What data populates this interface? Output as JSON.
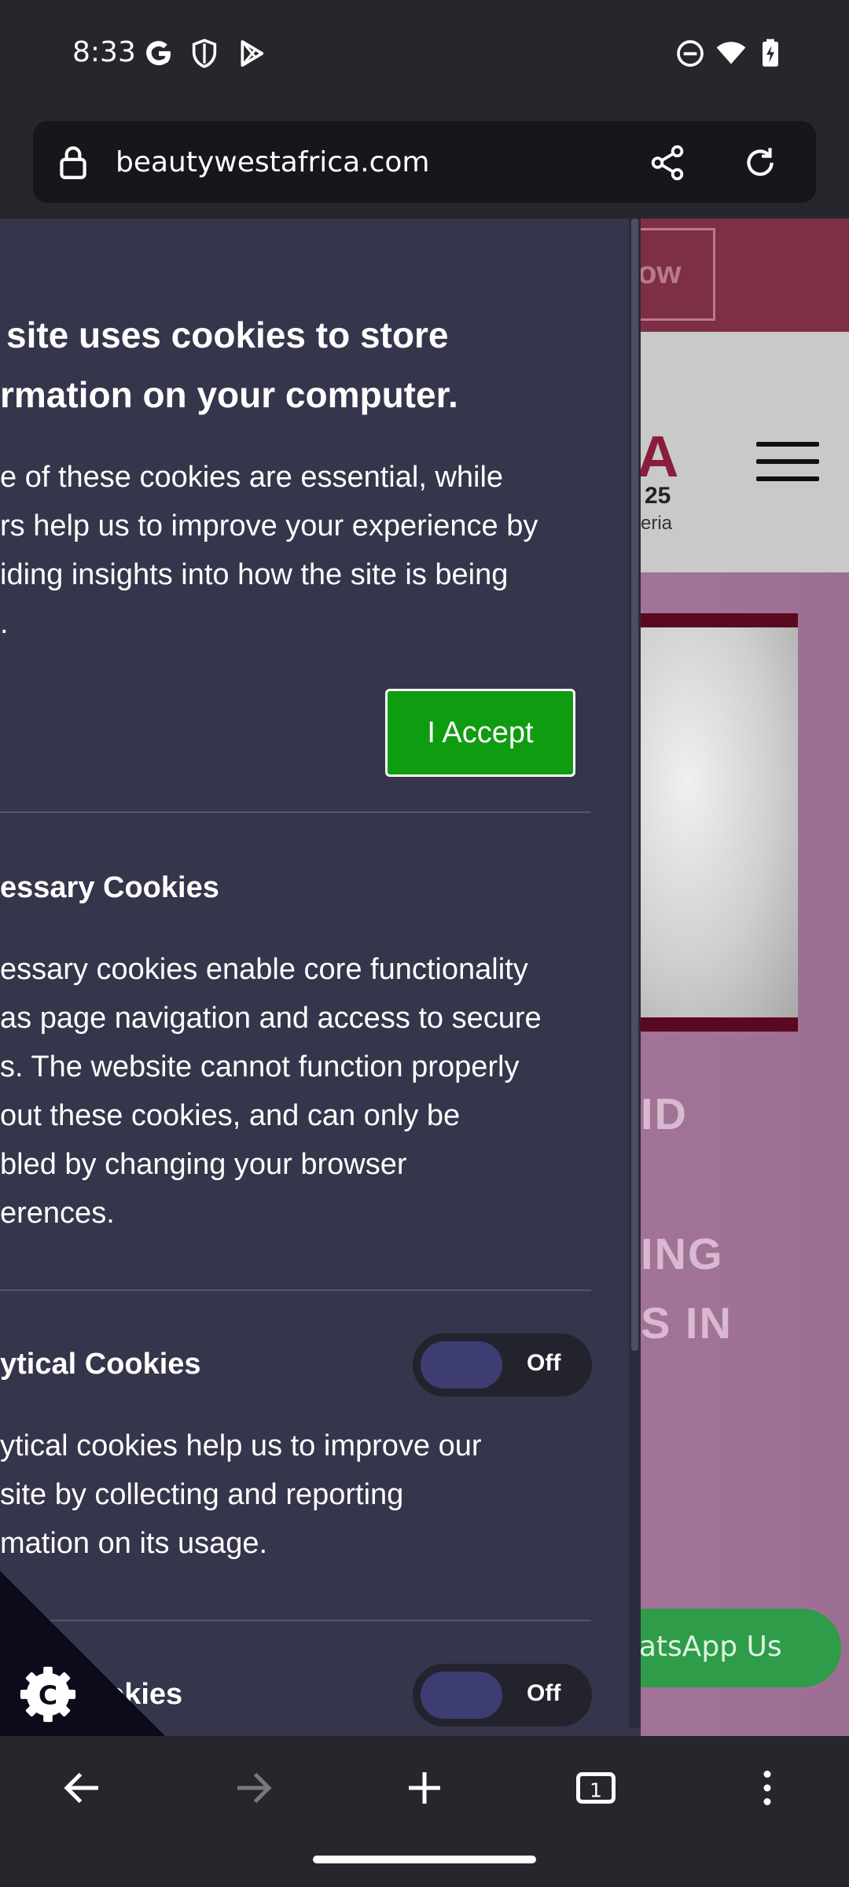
{
  "status_bar": {
    "time": "8:33",
    "left_icons": [
      "google-icon",
      "shield-icon",
      "play-store-icon"
    ],
    "right_icons": [
      "do-not-disturb-icon",
      "wifi-icon",
      "battery-charging-icon"
    ]
  },
  "browser": {
    "url": "beautywestafrica.com",
    "icons": [
      "lock-icon",
      "share-icon",
      "reload-icon"
    ],
    "tab_count": "1"
  },
  "site": {
    "top_button_partial": "ow",
    "logo_partial": "A",
    "logo_year_partial": "25",
    "logo_country_partial": "eria",
    "banner_lines": [
      "ID",
      "ING",
      "S IN"
    ],
    "whatsapp_label": "hatsApp Us"
  },
  "cookie_panel": {
    "title_lines": [
      "site uses cookies to store",
      "rmation on your computer."
    ],
    "intro_lines": [
      "e of these cookies are essential, while",
      "rs help us to improve your experience by",
      "iding insights into how the site is being",
      "."
    ],
    "accept_label": "I Accept",
    "necessary": {
      "heading": "essary Cookies",
      "lines": [
        "essary cookies enable core functionality",
        "as page navigation and access to secure",
        "s. The website cannot function properly",
        "out these cookies, and can only be",
        "bled by changing your browser",
        "erences."
      ]
    },
    "analytical": {
      "heading": "ytical Cookies",
      "toggle_label": "Off",
      "lines": [
        "ytical cookies help us to improve our",
        "site by collecting and reporting",
        "mation on its usage."
      ]
    },
    "third": {
      "heading": "okies",
      "toggle_label": "Off"
    },
    "fab_icon": "cookie-settings-icon"
  },
  "colors": {
    "panel_bg": "#35354b",
    "accept_bg": "#109c10",
    "site_accent": "#7d2f45",
    "whatsapp_green": "#2e9c49"
  }
}
